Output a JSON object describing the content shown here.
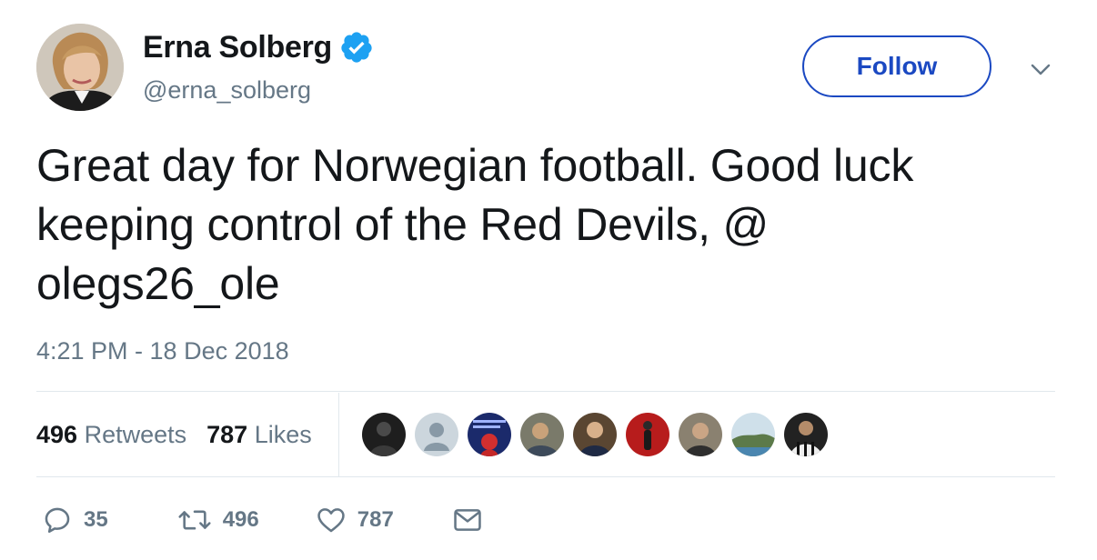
{
  "author": {
    "name": "Erna Solberg",
    "handle": "@erna_solberg",
    "verified": true
  },
  "follow_label": "Follow",
  "tweet": {
    "line1": "Great day for Norwegian football. Good luck",
    "line2": "keeping control of the Red Devils, @",
    "line3": "olegs26_ole",
    "timestamp": "4:21 PM - 18 Dec 2018"
  },
  "stats": {
    "retweets_count": "496",
    "retweets_label": "Retweets",
    "likes_count": "787",
    "likes_label": "Likes"
  },
  "actions": {
    "replies": "35",
    "retweets": "496",
    "likes": "787"
  },
  "colors": {
    "accent": "#1b49c2",
    "verified": "#1da1f2",
    "muted": "#657786",
    "text": "#14171a",
    "border": "#e1e8ed"
  }
}
